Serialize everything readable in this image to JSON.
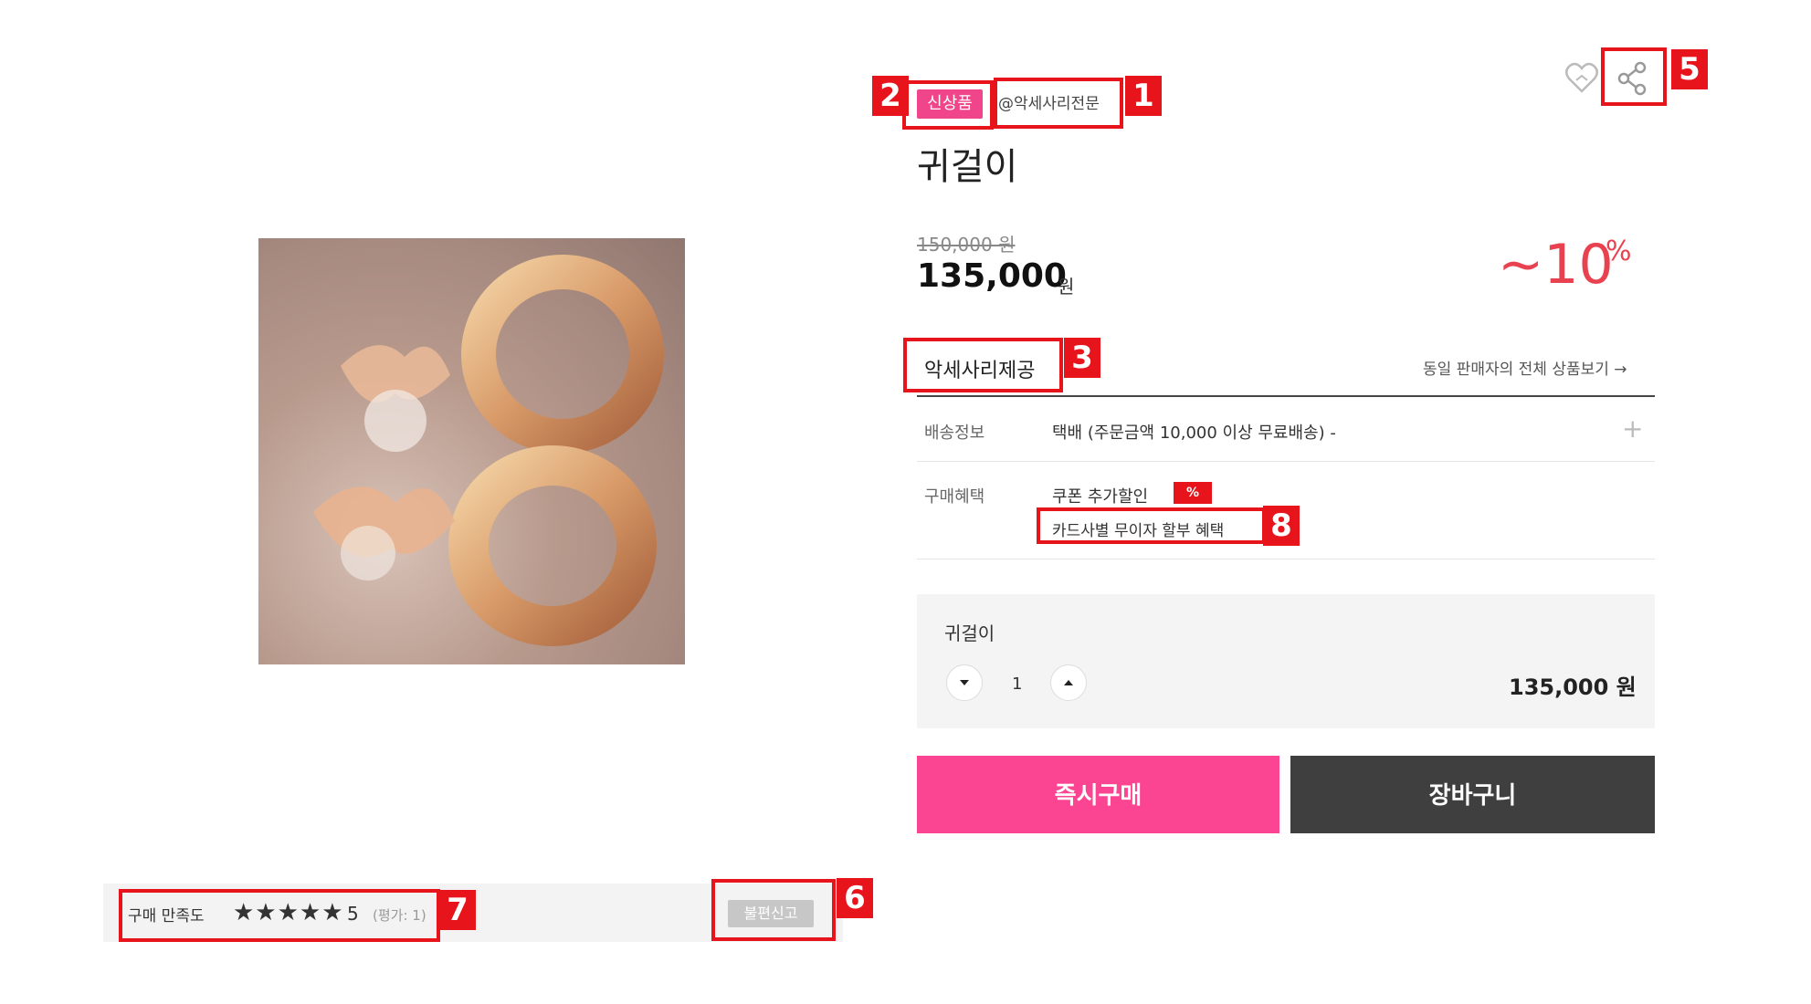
{
  "product": {
    "tag_new": "신상품",
    "seller_handle": "@악세사리전문",
    "title": "귀걸이",
    "original_price": "150,000 원",
    "price": "135,000",
    "price_unit": "원",
    "discount": "~10",
    "discount_symbol": "%"
  },
  "seller": {
    "name": "악세사리제공",
    "all_products_link": "동일 판매자의 전체 상품보기 →"
  },
  "info": {
    "shipping_label": "배송정보",
    "shipping_value": "택배 (주문금액 10,000 이상 무료배송) -",
    "benefits_label": "구매혜택",
    "coupon_text": "쿠폰 추가할인",
    "coupon_badge": "%",
    "card_benefit": "카드사별 무이자 할부 혜택"
  },
  "option": {
    "name": "귀걸이",
    "quantity": "1",
    "price": "135,000 원"
  },
  "buttons": {
    "buy_now": "즉시구매",
    "cart": "장바구니"
  },
  "rating": {
    "label": "구매 만족도",
    "stars": "★★★★★",
    "score": "5",
    "count": "(평가: 1)",
    "report": "불편신고"
  },
  "annotations": [
    "1",
    "2",
    "3",
    "5",
    "6",
    "7",
    "8"
  ],
  "colors": {
    "accent_pink": "#fb4592",
    "annotation_red": "#e8141c",
    "discount_red": "#e8414f"
  }
}
